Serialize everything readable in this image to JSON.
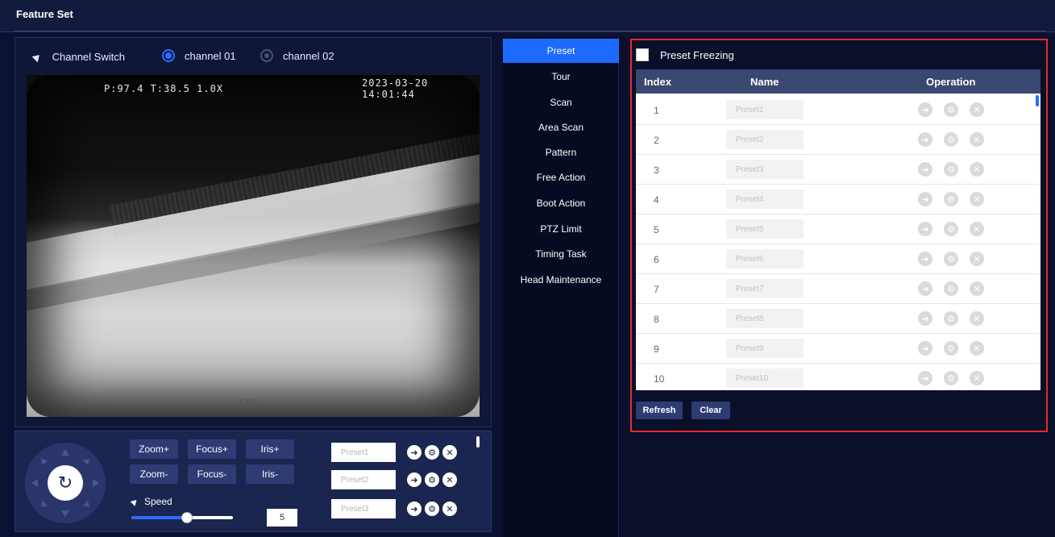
{
  "window": {
    "title": "Feature Set"
  },
  "channel": {
    "toggle_label": "Channel Switch",
    "options": [
      {
        "label": "channel 01",
        "selected": true
      },
      {
        "label": "channel 02",
        "selected": false
      }
    ]
  },
  "video": {
    "osd_ptz": "P:97.4 T:38.5 1.0X",
    "osd_time": "2023-03-20 14:01:44",
    "osd_channel": "CH1"
  },
  "ptz": {
    "buttons": {
      "zoom_in": "Zoom+",
      "zoom_out": "Zoom-",
      "focus_in": "Focus+",
      "focus_out": "Focus-",
      "iris_in": "Iris+",
      "iris_out": "Iris-"
    },
    "speed_label": "Speed",
    "speed_value": "5",
    "speed_fraction": 0.55,
    "presets": [
      "Preset1",
      "Preset2",
      "Preset3"
    ]
  },
  "menu": {
    "items": [
      "Preset",
      "Tour",
      "Scan",
      "Area Scan",
      "Pattern",
      "Free Action",
      "Boot Action",
      "PTZ Limit",
      "Timing Task",
      "Head Maintenance"
    ],
    "active": "Preset"
  },
  "preset_panel": {
    "freeze_label": "Preset Freezing",
    "columns": {
      "index": "Index",
      "name": "Name",
      "operation": "Operation"
    },
    "rows": [
      {
        "index": "1",
        "name": "Preset1"
      },
      {
        "index": "2",
        "name": "Preset2"
      },
      {
        "index": "3",
        "name": "Preset3"
      },
      {
        "index": "4",
        "name": "Preset4"
      },
      {
        "index": "5",
        "name": "Preset5"
      },
      {
        "index": "6",
        "name": "Preset6"
      },
      {
        "index": "7",
        "name": "Preset7"
      },
      {
        "index": "8",
        "name": "Preset8"
      },
      {
        "index": "9",
        "name": "Preset9"
      },
      {
        "index": "10",
        "name": "Preset10"
      }
    ],
    "refresh_label": "Refresh",
    "clear_label": "Clear"
  },
  "colors": {
    "accent": "#1e6bff",
    "highlight_border": "#e8282a",
    "panel_bg": "#0b1130"
  }
}
